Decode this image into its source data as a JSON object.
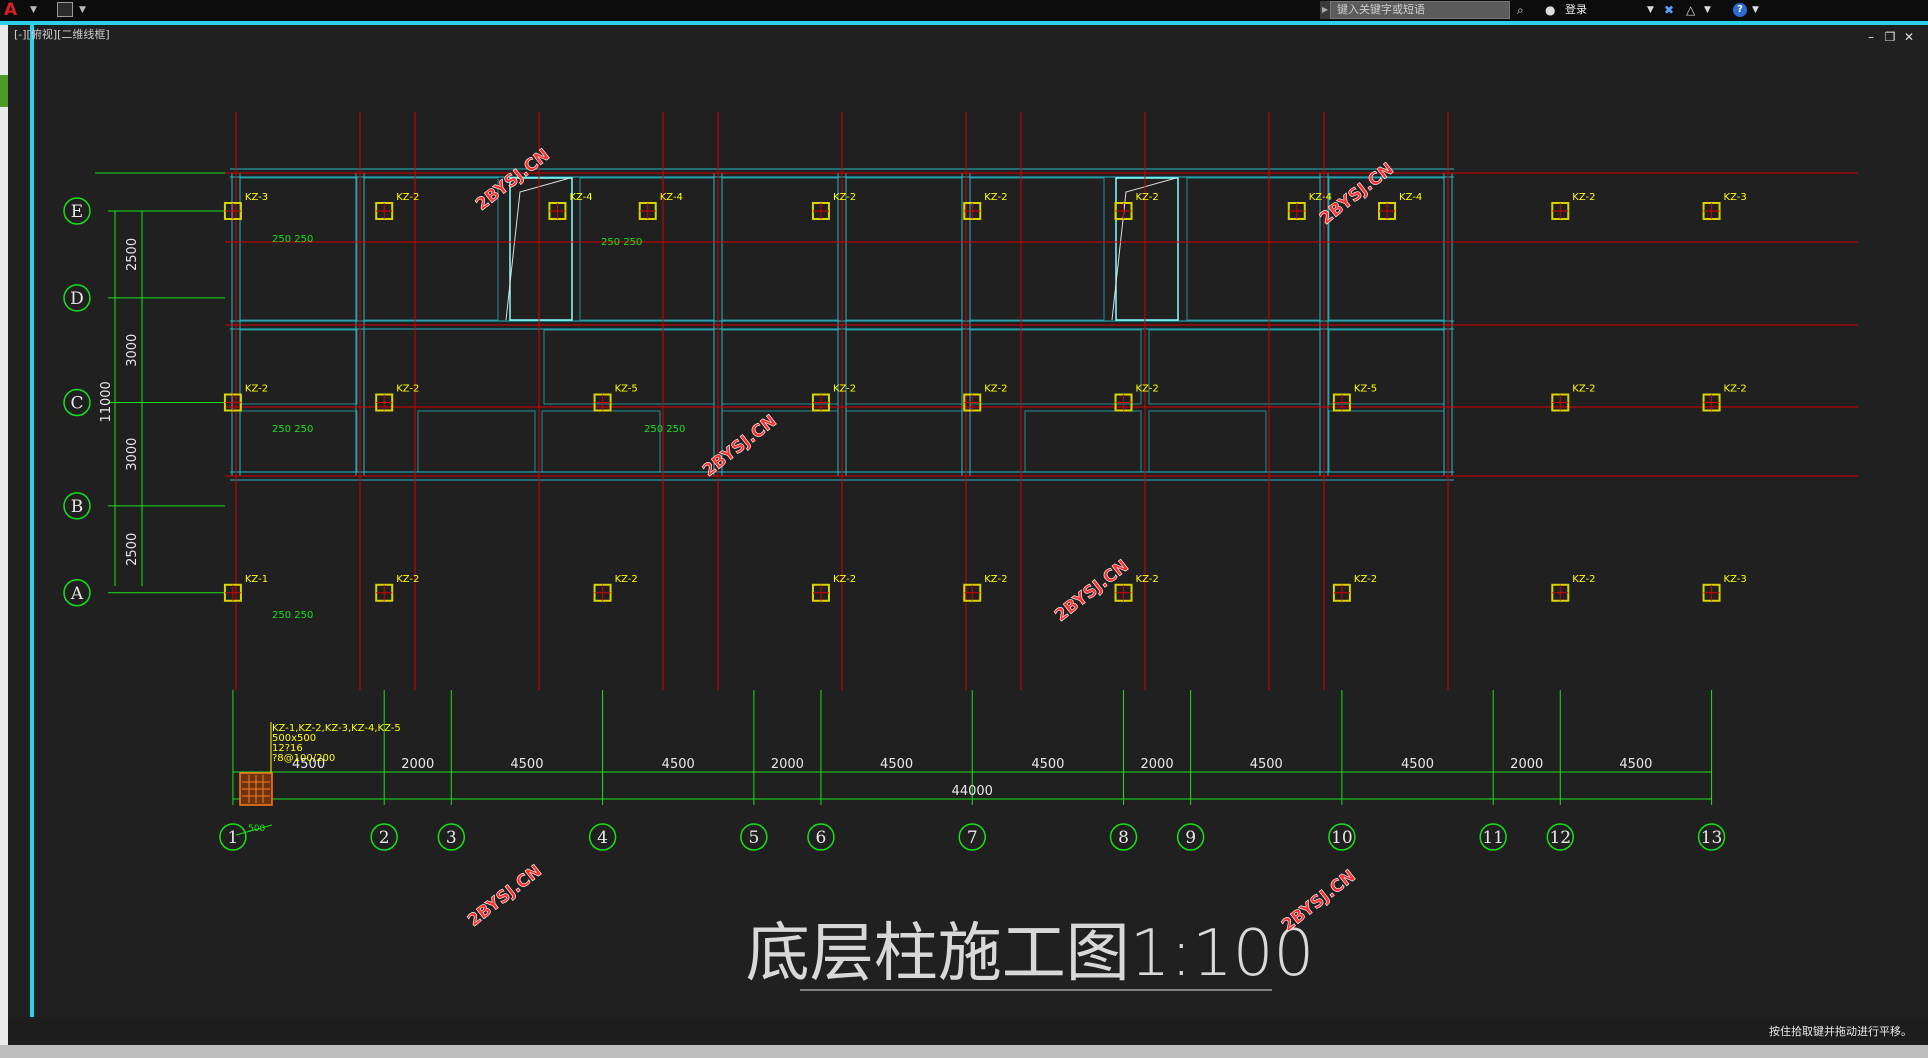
{
  "toolbar": {
    "search_placeholder": "键入关键字或短语",
    "login_label": "登录"
  },
  "viewport": {
    "label": "[-][俯视][二维线框]"
  },
  "status": {
    "message": "按住拾取键并拖动进行平移。"
  },
  "drawing": {
    "title": "底层柱施工图1:100",
    "row_axes": [
      "E",
      "D",
      "C",
      "B",
      "A"
    ],
    "row_dimensions": [
      "2500",
      "3000",
      "3000",
      "2500"
    ],
    "row_total": "11000",
    "column_axes": [
      "1",
      "2",
      "3",
      "4",
      "5",
      "6",
      "7",
      "8",
      "9",
      "10",
      "11",
      "12",
      "13"
    ],
    "column_dimensions": [
      "4500",
      "2000",
      "4500",
      "4500",
      "2000",
      "4500",
      "4500",
      "2000",
      "4500",
      "4500",
      "2000",
      "4500"
    ],
    "column_total": "44000",
    "columns": {
      "E": [
        [
          "1",
          "KZ-3"
        ],
        [
          "2",
          "KZ-2"
        ],
        [
          "4a",
          "KZ-4"
        ],
        [
          "4b",
          "KZ-4"
        ],
        [
          "6",
          "KZ-2"
        ],
        [
          "7",
          "KZ-2"
        ],
        [
          "8",
          "KZ-2"
        ],
        [
          "10a",
          "KZ-4"
        ],
        [
          "10b",
          "KZ-4"
        ],
        [
          "12",
          "KZ-2"
        ],
        [
          "13",
          "KZ-3"
        ]
      ],
      "C": [
        [
          "1",
          "KZ-2"
        ],
        [
          "2",
          "KZ-2"
        ],
        [
          "4",
          "KZ-5"
        ],
        [
          "6",
          "KZ-2"
        ],
        [
          "7",
          "KZ-2"
        ],
        [
          "8",
          "KZ-2"
        ],
        [
          "10",
          "KZ-5"
        ],
        [
          "12",
          "KZ-2"
        ],
        [
          "13",
          "KZ-2"
        ]
      ],
      "A": [
        [
          "1",
          "KZ-1"
        ],
        [
          "2",
          "KZ-2"
        ],
        [
          "4",
          "KZ-2"
        ],
        [
          "6",
          "KZ-2"
        ],
        [
          "7",
          "KZ-2"
        ],
        [
          "8",
          "KZ-2"
        ],
        [
          "10",
          "KZ-2"
        ],
        [
          "12",
          "KZ-2"
        ],
        [
          "13",
          "KZ-3"
        ]
      ]
    },
    "offset_label": "250 250",
    "column_spec": {
      "line1": "KZ-1,KZ-2,KZ-3,KZ-4,KZ-5",
      "line2": "500x500",
      "line3": "12?16",
      "line4": "?8@100/200"
    },
    "detail_dim": "500",
    "watermark": "2BYSJ.CN",
    "colors": {
      "background": "#202020",
      "axis_line": "#d40000",
      "dim_line": "#18e018",
      "beam": "#25b9c7",
      "column_fill": "#d9d400",
      "text": "#ffff00",
      "title": "#e8e8e8",
      "watermark": "#ff3030"
    }
  }
}
